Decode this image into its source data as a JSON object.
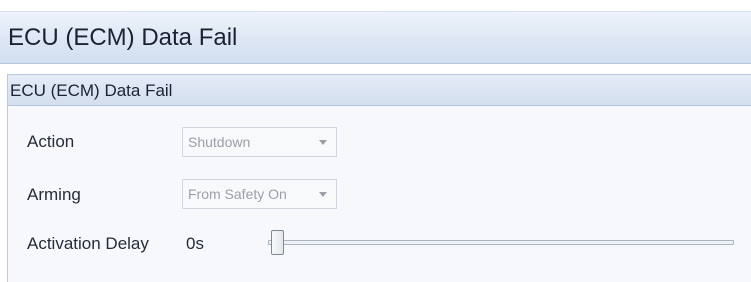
{
  "page": {
    "title": "ECU (ECM) Data Fail"
  },
  "group": {
    "title": "ECU (ECM) Data Fail",
    "fields": {
      "action": {
        "label": "Action",
        "value": "Shutdown",
        "enabled": false
      },
      "arming": {
        "label": "Arming",
        "value": "From Safety On",
        "enabled": false
      },
      "activation_delay": {
        "label": "Activation Delay",
        "value_text": "0s",
        "slider_position": 0
      }
    }
  },
  "icons": {
    "dropdown": "chevron-down-icon"
  },
  "colors": {
    "header_bg": "#dde7f4",
    "group_header_bg": "#d3dfee",
    "disabled_text": "#9aa0a8",
    "border": "#b9c8dc"
  }
}
